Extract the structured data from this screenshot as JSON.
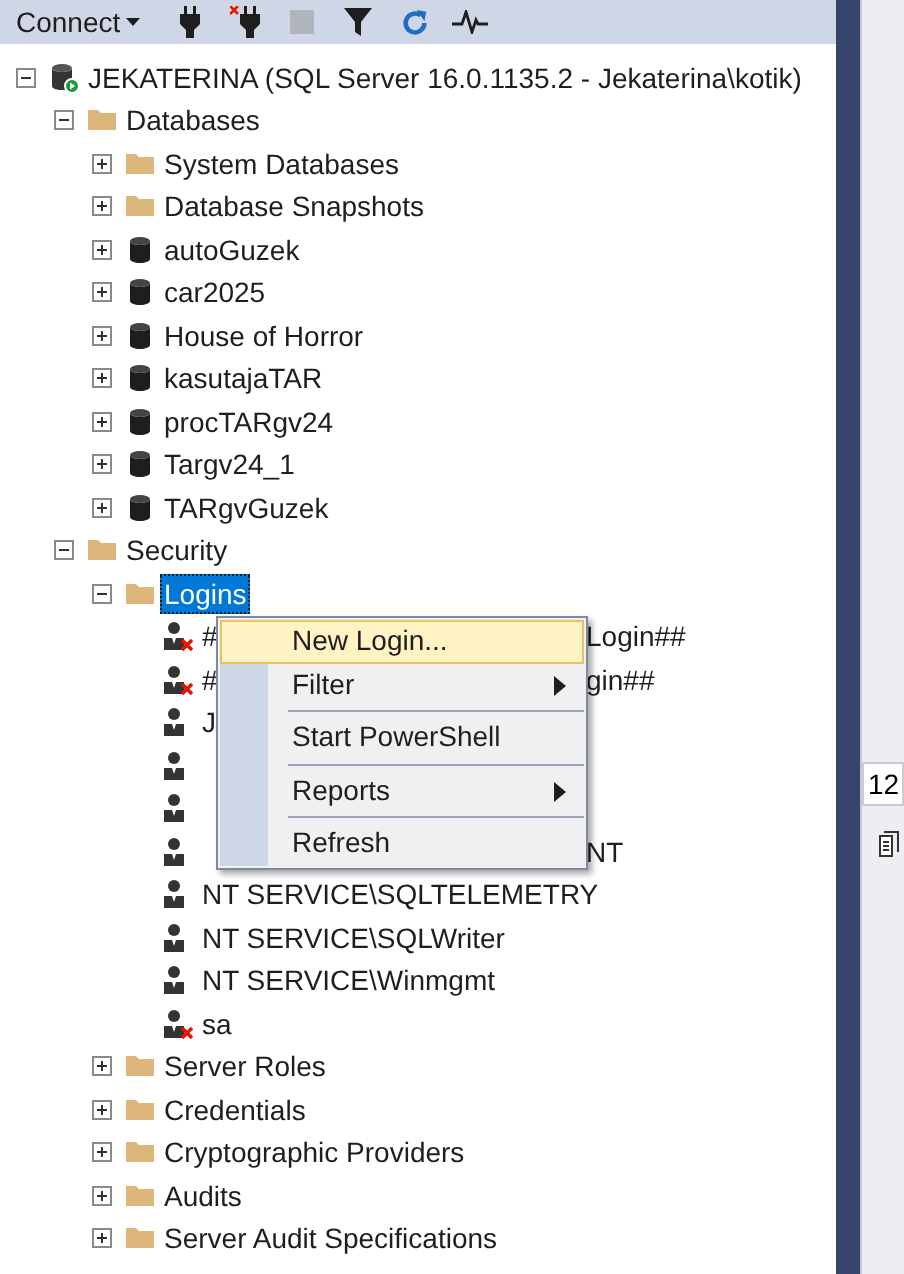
{
  "toolbar": {
    "connect": {
      "label": "Connect"
    },
    "tools": [
      {
        "kind": "connect",
        "disabled": false
      },
      {
        "kind": "disconnect",
        "disabled": false
      },
      {
        "kind": "stop",
        "disabled": true
      },
      {
        "kind": "filter",
        "disabled": false
      },
      {
        "kind": "refresh",
        "disabled": false
      },
      {
        "kind": "activity",
        "disabled": false
      }
    ]
  },
  "tree": [
    {
      "kind": "server",
      "label": "JEKATERINA (SQL Server 16.0.1135.2 - Jekaterina\\kotik)",
      "expanded": true,
      "selected": false,
      "children": [
        {
          "kind": "folder",
          "label": "Databases",
          "expanded": true,
          "selected": false,
          "children": [
            {
              "kind": "folder",
              "label": "System Databases",
              "expanded": false,
              "selected": false
            },
            {
              "kind": "folder",
              "label": "Database Snapshots",
              "expanded": false,
              "selected": false
            },
            {
              "kind": "database",
              "label": "autoGuzek",
              "expanded": false,
              "selected": false
            },
            {
              "kind": "database",
              "label": "car2025",
              "expanded": false,
              "selected": false
            },
            {
              "kind": "database",
              "label": "House of Horror",
              "expanded": false,
              "selected": false
            },
            {
              "kind": "database",
              "label": "kasutajaTAR",
              "expanded": false,
              "selected": false
            },
            {
              "kind": "database",
              "label": "procTARgv24",
              "expanded": false,
              "selected": false
            },
            {
              "kind": "database",
              "label": "Targv24_1",
              "expanded": false,
              "selected": false
            },
            {
              "kind": "database",
              "label": "TARgvGuzek",
              "expanded": false,
              "selected": false
            }
          ]
        },
        {
          "kind": "folder",
          "label": "Security",
          "expanded": true,
          "selected": false,
          "children": [
            {
              "kind": "folder",
              "label": "Logins",
              "expanded": true,
              "selected": true,
              "children": [
                {
                  "kind": "login",
                  "label": "#",
                  "label_end": "Login##",
                  "disabled": true,
                  "selected": false
                },
                {
                  "kind": "login",
                  "label": "#",
                  "label_end": "gin##",
                  "disabled": true,
                  "selected": false
                },
                {
                  "kind": "login",
                  "label": "J",
                  "disabled": false,
                  "selected": false
                },
                {
                  "kind": "login",
                  "disabled": false
                },
                {
                  "kind": "login",
                  "disabled": false
                },
                {
                  "kind": "login",
                  "label_end": "NT",
                  "disabled": false,
                  "selected": false
                },
                {
                  "kind": "login",
                  "label": "NT SERVICE\\SQLTELEMETRY",
                  "disabled": false,
                  "selected": false
                },
                {
                  "kind": "login",
                  "label": "NT SERVICE\\SQLWriter",
                  "disabled": false,
                  "selected": false
                },
                {
                  "kind": "login",
                  "label": "NT SERVICE\\Winmgmt",
                  "disabled": false,
                  "selected": false
                },
                {
                  "kind": "login",
                  "label": "sa",
                  "disabled": true,
                  "selected": false
                }
              ]
            },
            {
              "kind": "folder",
              "label": "Server Roles",
              "expanded": false,
              "selected": false
            },
            {
              "kind": "folder",
              "label": "Credentials",
              "expanded": false,
              "selected": false
            },
            {
              "kind": "folder",
              "label": "Cryptographic Providers",
              "expanded": false,
              "selected": false
            },
            {
              "kind": "folder",
              "label": "Audits",
              "expanded": false,
              "selected": false
            },
            {
              "kind": "folder",
              "label": "Server Audit Specifications",
              "expanded": false,
              "selected": false
            }
          ]
        }
      ]
    }
  ],
  "context_menu": {
    "items": [
      {
        "kind": "item",
        "label": "New Login...",
        "selected": true,
        "submenu": false
      },
      {
        "kind": "item",
        "label": "Filter",
        "selected": false,
        "submenu": true
      },
      {
        "kind": "separator"
      },
      {
        "kind": "item",
        "label": "Start PowerShell",
        "selected": false,
        "submenu": false
      },
      {
        "kind": "separator"
      },
      {
        "kind": "item",
        "label": "Reports",
        "selected": false,
        "submenu": true
      },
      {
        "kind": "separator"
      },
      {
        "kind": "item",
        "label": "Refresh",
        "selected": false,
        "submenu": false
      }
    ]
  },
  "side_panel": {
    "field_value": "12"
  }
}
